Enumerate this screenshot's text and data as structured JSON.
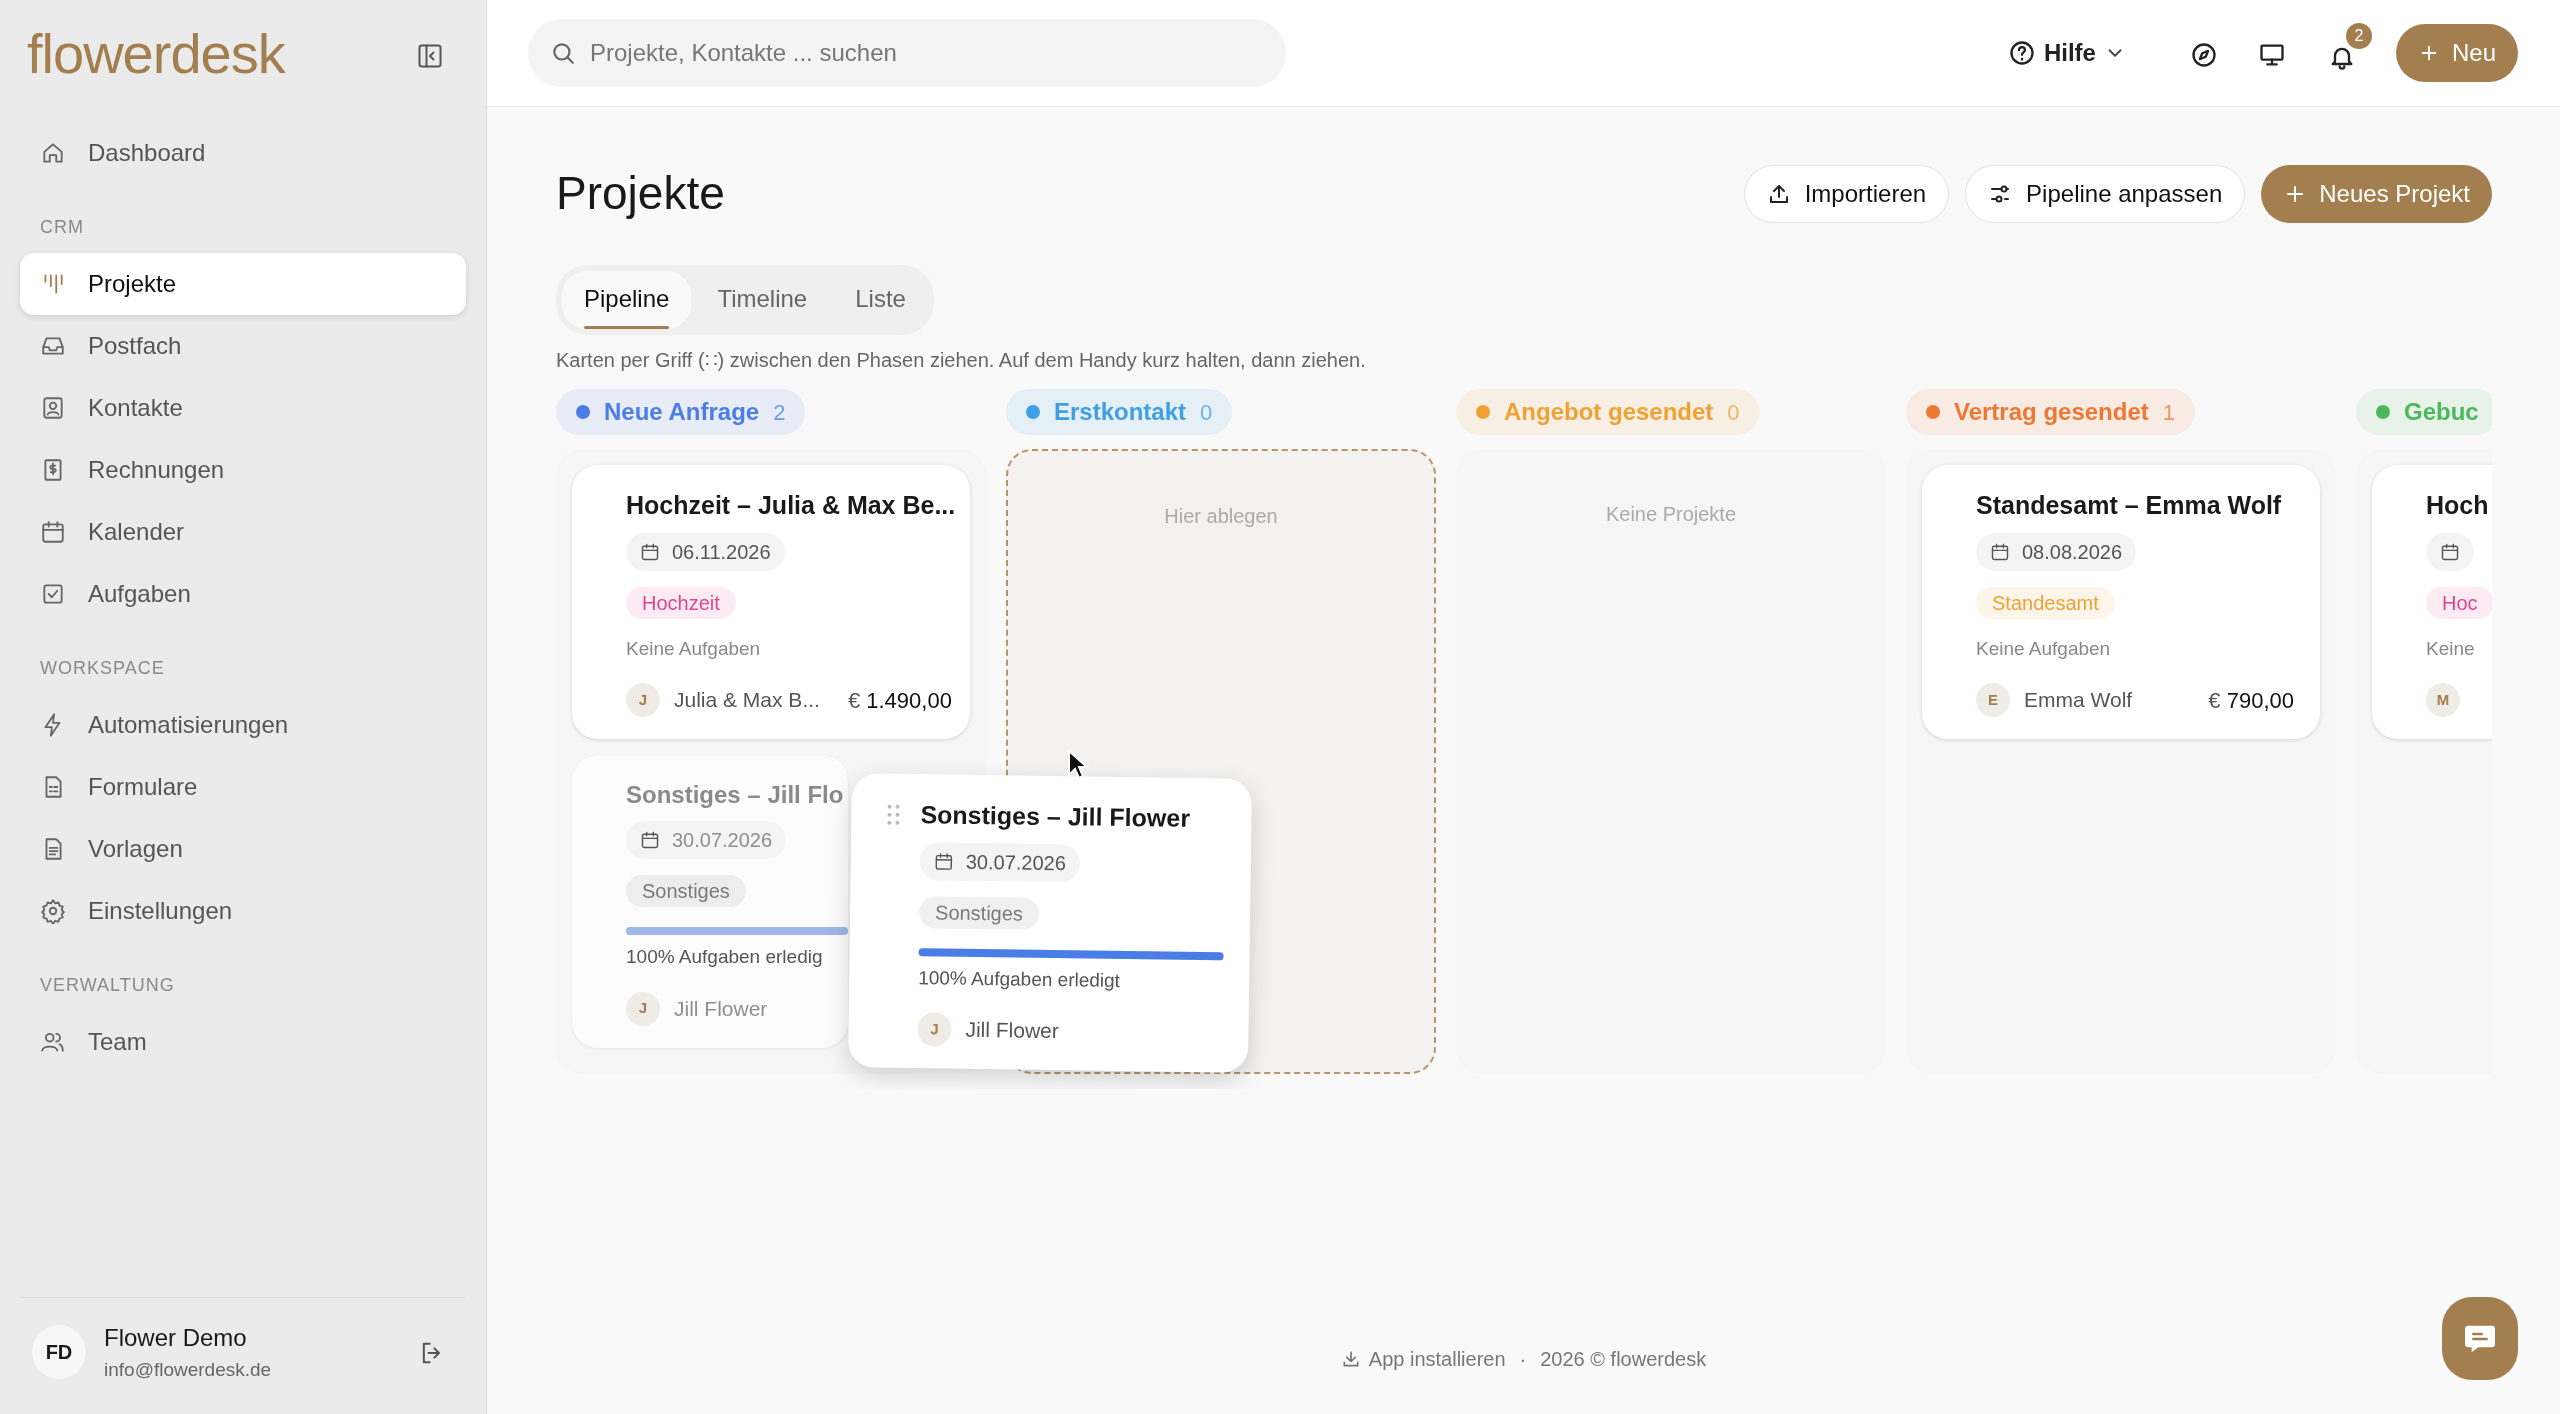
{
  "logo": "flowerdesk",
  "sidebar": {
    "sections": [
      {
        "items": [
          {
            "label": "Dashboard",
            "selected": false
          }
        ]
      },
      {
        "label": "CRM",
        "items": [
          {
            "label": "Projekte",
            "selected": true
          },
          {
            "label": "Postfach",
            "selected": false
          },
          {
            "label": "Kontakte",
            "selected": false
          },
          {
            "label": "Rechnungen",
            "selected": false
          },
          {
            "label": "Kalender",
            "selected": false
          },
          {
            "label": "Aufgaben",
            "selected": false
          }
        ]
      },
      {
        "label": "WORKSPACE",
        "items": [
          {
            "label": "Automatisierungen",
            "selected": false
          },
          {
            "label": "Formulare",
            "selected": false
          },
          {
            "label": "Vorlagen",
            "selected": false
          },
          {
            "label": "Einstellungen",
            "selected": false
          }
        ]
      },
      {
        "label": "VERWALTUNG",
        "items": [
          {
            "label": "Team",
            "selected": false
          }
        ]
      }
    ]
  },
  "user": {
    "initials": "FD",
    "name": "Flower Demo",
    "email": "info@flowerdesk.de"
  },
  "search": {
    "placeholder": "Projekte, Kontakte ... suchen"
  },
  "header": {
    "help": "Hilfe",
    "notifications": "2",
    "new_button": "Neu"
  },
  "page": {
    "title": "Projekte",
    "buttons": [
      {
        "label": "Importieren",
        "kind": "import"
      },
      {
        "label": "Pipeline anpassen",
        "kind": "settings"
      },
      {
        "label": "Neues Projekt",
        "kind": "primary"
      }
    ]
  },
  "tabs": [
    {
      "label": "Pipeline",
      "selected": true
    },
    {
      "label": "Timeline",
      "selected": false
    },
    {
      "label": "Liste",
      "selected": false
    }
  ],
  "hint": "Karten per Griff (∷) zwischen den Phasen ziehen. Auf dem Handy kurz halten, dann ziehen.",
  "columns": [
    {
      "name": "Neue Anfrage",
      "count": "2",
      "color": "#4a7ee6",
      "kind": "list",
      "cards": [
        {
          "title": "Hochzeit – Julia & Max Be...",
          "date": "06.11.2026",
          "tag": {
            "label": "Hochzeit",
            "color": "#e0468c"
          },
          "tasks_text": "Keine Aufgaben",
          "contact_initial": "J",
          "contact": "Julia & Max B...",
          "currency": "€",
          "amount": "1.490,00",
          "ghost": false
        },
        {
          "title": "Sonstiges – Jill Flo",
          "date": "30.07.2026",
          "tag": {
            "label": "Sonstiges",
            "color": "#7a7a7a"
          },
          "level": 1,
          "tasks_text": "100% Aufgaben erledig",
          "contact_initial": "J",
          "contact": "Jill Flower",
          "ghost": true
        }
      ]
    },
    {
      "name": "Erstkontakt",
      "count": "0",
      "color": "#3f9fe2",
      "kind": "drop-zone",
      "empty_text": "Hier ablegen"
    },
    {
      "name": "Angebot gesendet",
      "count": "0",
      "color": "#f0a133",
      "kind": "list",
      "empty_text": "Keine Projekte"
    },
    {
      "name": "Vertrag gesendet",
      "count": "1",
      "color": "#ee7733",
      "kind": "list",
      "cards": [
        {
          "title": "Standesamt – Emma Wolf",
          "date": "08.08.2026",
          "tag": {
            "label": "Standesamt",
            "color": "#f0a133"
          },
          "tasks_text": "Keine Aufgaben",
          "contact_initial": "E",
          "contact": "Emma Wolf",
          "currency": "€",
          "amount": "790,00",
          "ghost": false
        }
      ]
    },
    {
      "name": "Gebuc",
      "color": "#4cb85c",
      "kind": "list",
      "cards": [
        {
          "title": "Hoch",
          "tag": {
            "label": "Hoc",
            "color": "#e0468c"
          },
          "tasks_text": "Keine",
          "contact_initial": "M",
          "ghost": false
        }
      ]
    }
  ],
  "drag_card": {
    "title": "Sonstiges – Jill Flower",
    "date": "30.07.2026",
    "tag": {
      "label": "Sonstiges",
      "color": "#7a7a7a"
    },
    "level": 1,
    "tasks_text": "100% Aufgaben erledigt",
    "contact_initial": "J",
    "contact": "Jill Flower"
  },
  "footer": {
    "install": "App installieren",
    "separator": "·",
    "copyright": "2026 © flowerdesk"
  }
}
